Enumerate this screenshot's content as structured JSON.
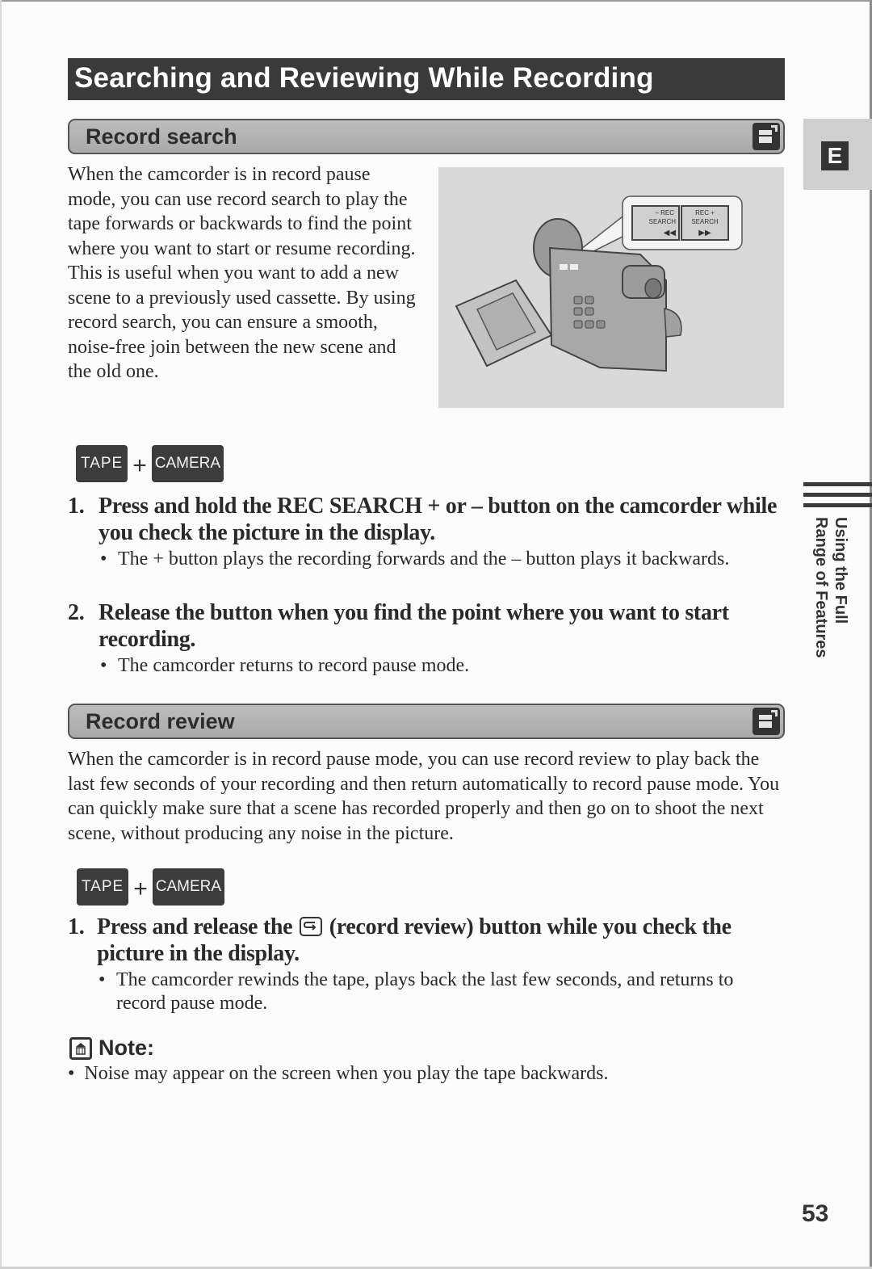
{
  "page": {
    "title": "Searching and Reviewing While Recording",
    "page_number": "53",
    "side_tab_letter": "E",
    "side_section_label": "Using the Full Range of Features"
  },
  "record_search": {
    "heading": "Record search",
    "intro": "When the camcorder is in record pause mode, you can use record search to play the tape forwards or backwards to find the point where you want to start or resume recording. This is useful when you want to add a new scene to a previously used cassette. By using record search, you can ensure a smooth, noise-free join between the new scene and the old one.",
    "illustration": {
      "button_minus_label_1": "– REC",
      "button_minus_label_2": "SEARCH",
      "button_minus_symbol": "◀◀",
      "button_plus_label_1": "REC +",
      "button_plus_label_2": "SEARCH",
      "button_plus_symbol": "▶▶"
    },
    "modes": [
      "TAPE",
      "CAMERA"
    ],
    "mode_joiner": "+",
    "steps": [
      {
        "number": "1.",
        "text": "Press and hold the REC SEARCH + or – button on the camcorder while you check the picture in the display.",
        "bullet": "The + button plays the recording forwards and the – button plays it backwards."
      },
      {
        "number": "2.",
        "text": "Release the button when you find the point where you want to start recording.",
        "bullet": "The camcorder returns to record pause mode."
      }
    ]
  },
  "record_review": {
    "heading": "Record review",
    "intro": "When the camcorder is in record pause mode, you can use record review to play back the last few seconds of your recording and then return automatically to record pause mode. You can quickly make sure that a scene has recorded properly and then go on to shoot the next scene, without producing any noise in the picture.",
    "modes": [
      "TAPE",
      "CAMERA"
    ],
    "mode_joiner": "+",
    "steps": [
      {
        "number": "1.",
        "text_before_icon": "Press and release the",
        "text_after_icon": "(record review) button while you check the picture in the display.",
        "bullet": "The camcorder rewinds the tape, plays back the last few seconds, and returns to record pause mode."
      }
    ]
  },
  "note": {
    "heading": "Note:",
    "bullet": "Noise may appear on the screen when you play the tape backwards."
  },
  "bullet_char": "•"
}
